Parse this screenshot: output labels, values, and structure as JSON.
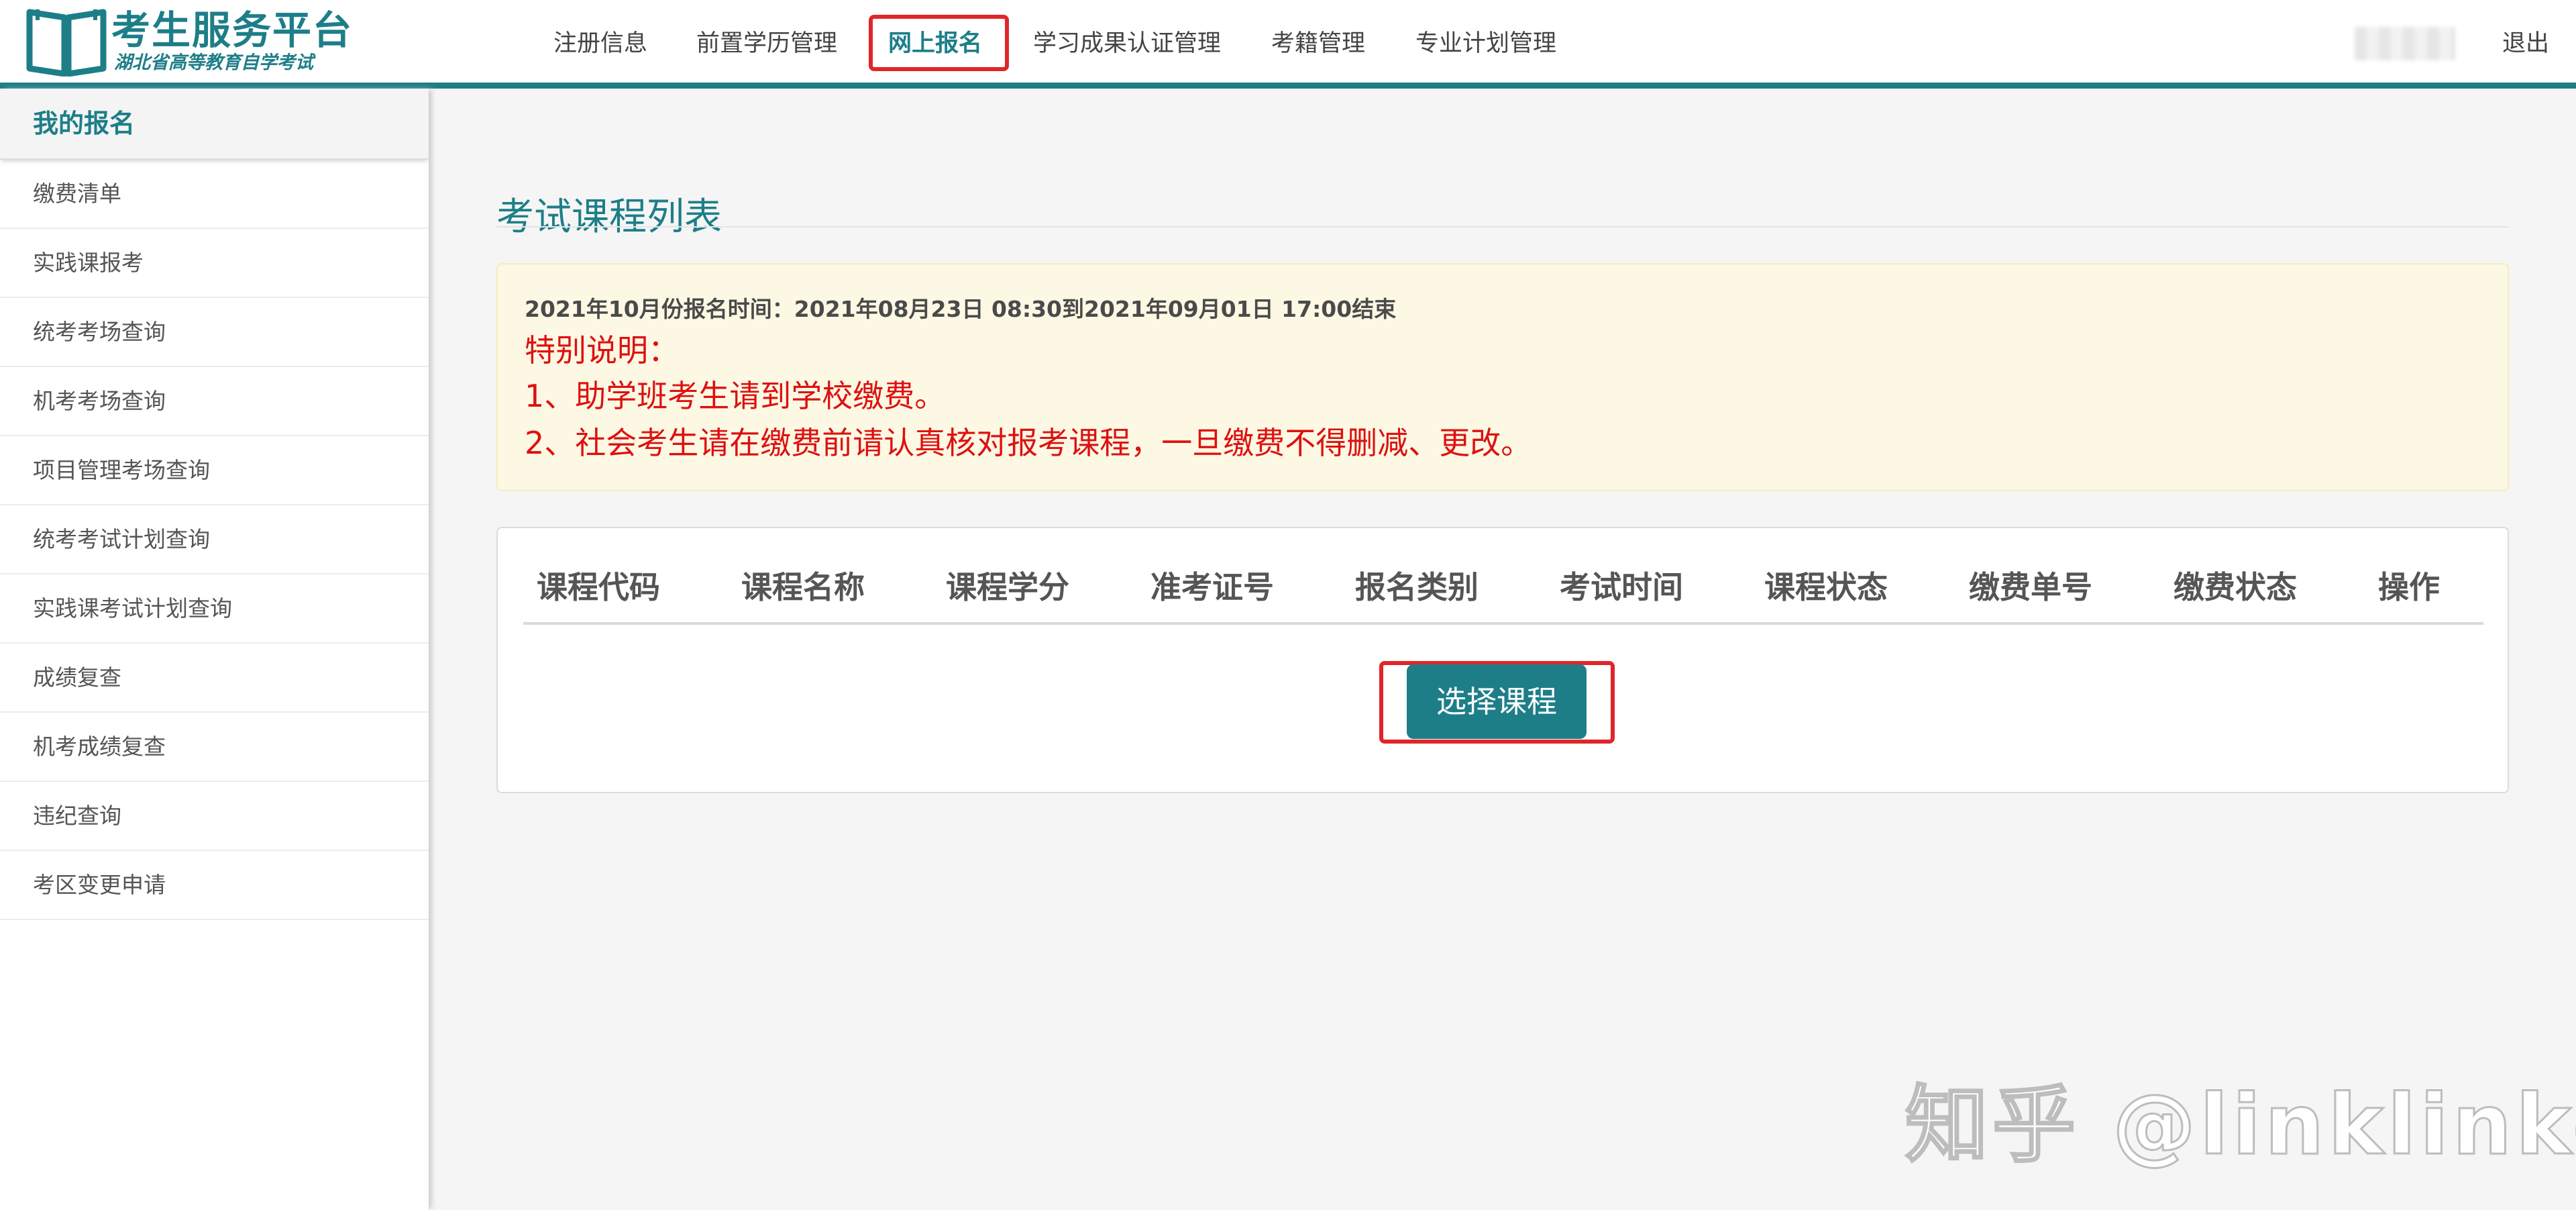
{
  "header": {
    "logo_title": "考生服务平台",
    "logo_subtitle": "湖北省高等教育自学考试",
    "nav": [
      {
        "label": "注册信息",
        "active": false
      },
      {
        "label": "前置学历管理",
        "active": false
      },
      {
        "label": "网上报名",
        "active": true
      },
      {
        "label": "学习成果认证管理",
        "active": false
      },
      {
        "label": "考籍管理",
        "active": false
      },
      {
        "label": "专业计划管理",
        "active": false
      }
    ],
    "logout_label": "退出"
  },
  "sidebar": {
    "heading": "我的报名",
    "items": [
      {
        "label": "缴费清单"
      },
      {
        "label": "实践课报考"
      },
      {
        "label": "统考考场查询"
      },
      {
        "label": "机考考场查询"
      },
      {
        "label": "项目管理考场查询"
      },
      {
        "label": "统考考试计划查询"
      },
      {
        "label": "实践课考试计划查询"
      },
      {
        "label": "成绩复查"
      },
      {
        "label": "机考成绩复查"
      },
      {
        "label": "违纪查询"
      },
      {
        "label": "考区变更申请"
      }
    ]
  },
  "main": {
    "title": "考试课程列表",
    "notice": {
      "time": "2021年10月份报名时间：2021年08月23日 08:30到2021年09月01日 17:00结束",
      "special_title": "特别说明：",
      "lines": [
        "1、助学班考生请到学校缴费。",
        "2、社会考生请在缴费前请认真核对报考课程，一旦缴费不得删减、更改。"
      ]
    },
    "table": {
      "columns": [
        "课程代码",
        "课程名称",
        "课程学分",
        "准考证号",
        "报名类别",
        "考试时间",
        "课程状态",
        "缴费单号",
        "缴费状态",
        "操作"
      ]
    },
    "select_button_label": "选择课程"
  },
  "watermark": "知乎 @linklinked",
  "colors": {
    "brand": "#1d7e88",
    "highlight": "#e0262a",
    "notice_bg": "#fcf8e3",
    "notice_text": "#dd1111"
  }
}
